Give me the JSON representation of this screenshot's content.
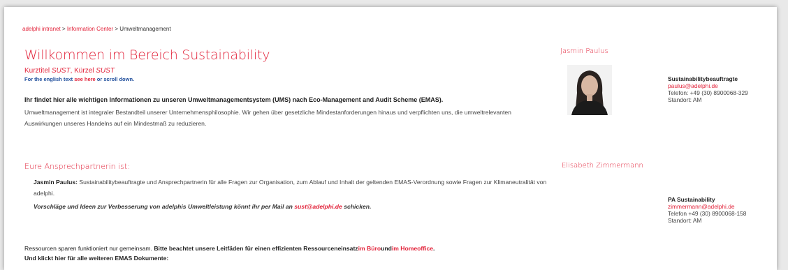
{
  "breadcrumb": {
    "item1": "adelphi intranet",
    "sep1": " > ",
    "item2": "Information Center",
    "sep2": " > ",
    "current": "Umweltmanagement"
  },
  "header": {
    "title": "Willkommen im Bereich Sustainability",
    "subtitle_prefix": "Kurztitel ",
    "subtitle_code1": "SUST",
    "subtitle_mid": ", Kürzel ",
    "subtitle_code2": "SUST",
    "english_prefix": "For the english text ",
    "english_link": "see here",
    "english_suffix": " or scroll down."
  },
  "intro": {
    "bold": "Ihr findet hier alle wichtigen Informationen zu unseren Umweltmanagementsystem (UMS) nach Eco-Management and Audit Scheme (EMAS).",
    "text": "Umweltmanagement ist integraler Bestandteil unserer Unternehmensphilosophie. Wir gehen über gesetzliche Mindestanforderungen hinaus und verpflichten uns, die umweltrelevanten Auswirkungen unseres Handelns auf ein Mindestmaß zu reduzieren."
  },
  "contact_section": {
    "heading": "Eure Ansprechpartnerin ist:",
    "name": "Jasmin Paulus:",
    "text": " Sustainabilitybeauftragte und Ansprechpartnerin für alle Fragen zur Organisation, zum Ablauf und Inhalt der geltenden EMAS-Verordnung sowie Fragen zur Klimaneutralität von adelphi.",
    "suggest_prefix": "Vorschläge und Ideen zur Verbesserung von adelphis Umweltleistung könnt ihr per Mail an ",
    "suggest_mail": "sust@adelphi.de",
    "suggest_suffix": " schicken."
  },
  "footer": {
    "line1_plain": "Ressourcen sparen funktioniert nur gemeinsam. ",
    "line1_bold": "Bitte beachtet unsere Leitfäden für einen effizienten Ressourceneinsatz",
    "link_office": "im Büro",
    "and": "und",
    "link_home": "im Homeoffice",
    "end": ".",
    "line2": "Und klickt hier für alle weiteren EMAS Dokumente:"
  },
  "person1": {
    "name": "Jasmin Paulus",
    "role": "Sustainabilitybeauftragte",
    "email": "paulus@adelphi.de",
    "phone": "Telefon: +49 (30) 8900068-329",
    "location": "Standort: AM"
  },
  "person2": {
    "name": "Elisabeth Zimmermann",
    "role": "PA Sustainability",
    "email": "zimmermann@adelphi.de",
    "phone": "Telefon +49 (30) 8900068-158",
    "location": "Standort: AM"
  },
  "colors": {
    "accent": "#e2233a",
    "link_blue": "#1f4e9c"
  }
}
